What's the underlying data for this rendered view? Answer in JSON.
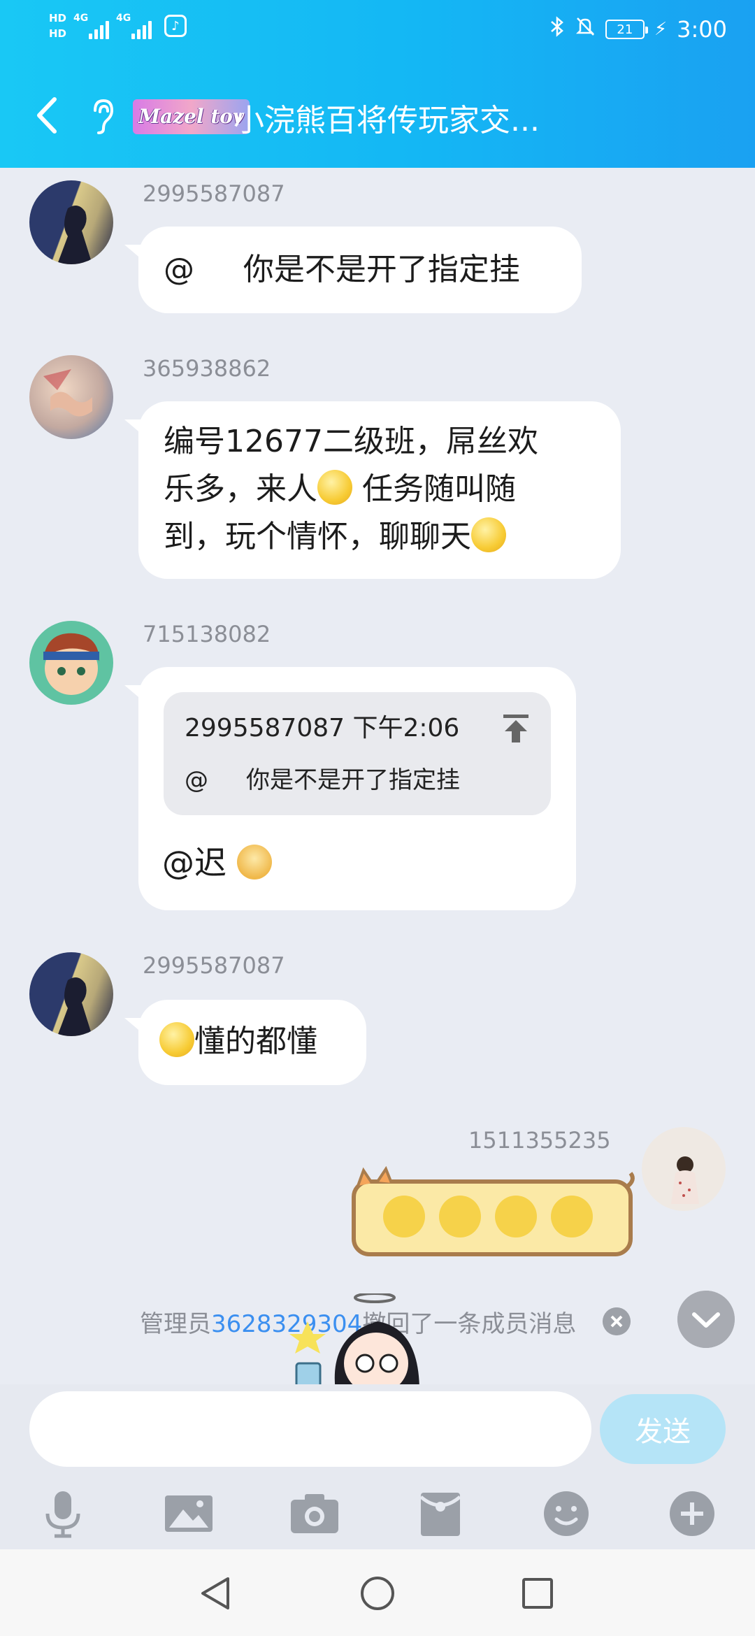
{
  "status_bar": {
    "hd1": "HD",
    "hd2": "HD",
    "net1": "4G",
    "net2": "4G",
    "battery": "21",
    "time": "3:00"
  },
  "header": {
    "group_badge": "Mazel tov",
    "title": "小浣熊百将传玩家交...",
    "accent_color": "#14b7f4"
  },
  "messages": [
    {
      "sender": "2995587087",
      "lines": [
        "@     你是不是开了指定挂"
      ]
    },
    {
      "sender": "365938862",
      "line1": "编号12677二级班，屌丝欢",
      "line2a": "乐多，来人",
      "line2b": "任务随叫随",
      "line3": "到，玩个情怀，聊聊天"
    },
    {
      "sender": "715138082",
      "quote": {
        "head": "2995587087 下午2:06",
        "body": "@     你是不是开了指定挂"
      },
      "reply": "@迟"
    },
    {
      "sender": "2995587087",
      "text": "懂的都懂"
    },
    {
      "sender": "1511355235"
    }
  ],
  "notice": {
    "prefix": "管理员",
    "link": "3628329304",
    "suffix": "撤回了一条成员消息"
  },
  "input": {
    "placeholder": "",
    "send_label": "发送"
  },
  "toolbar": [
    "microphone-icon",
    "image-icon",
    "camera-icon",
    "red-packet-icon",
    "emoji-icon",
    "plus-icon"
  ],
  "nav": [
    "back-triangle-icon",
    "home-circle-icon",
    "recents-square-icon"
  ]
}
